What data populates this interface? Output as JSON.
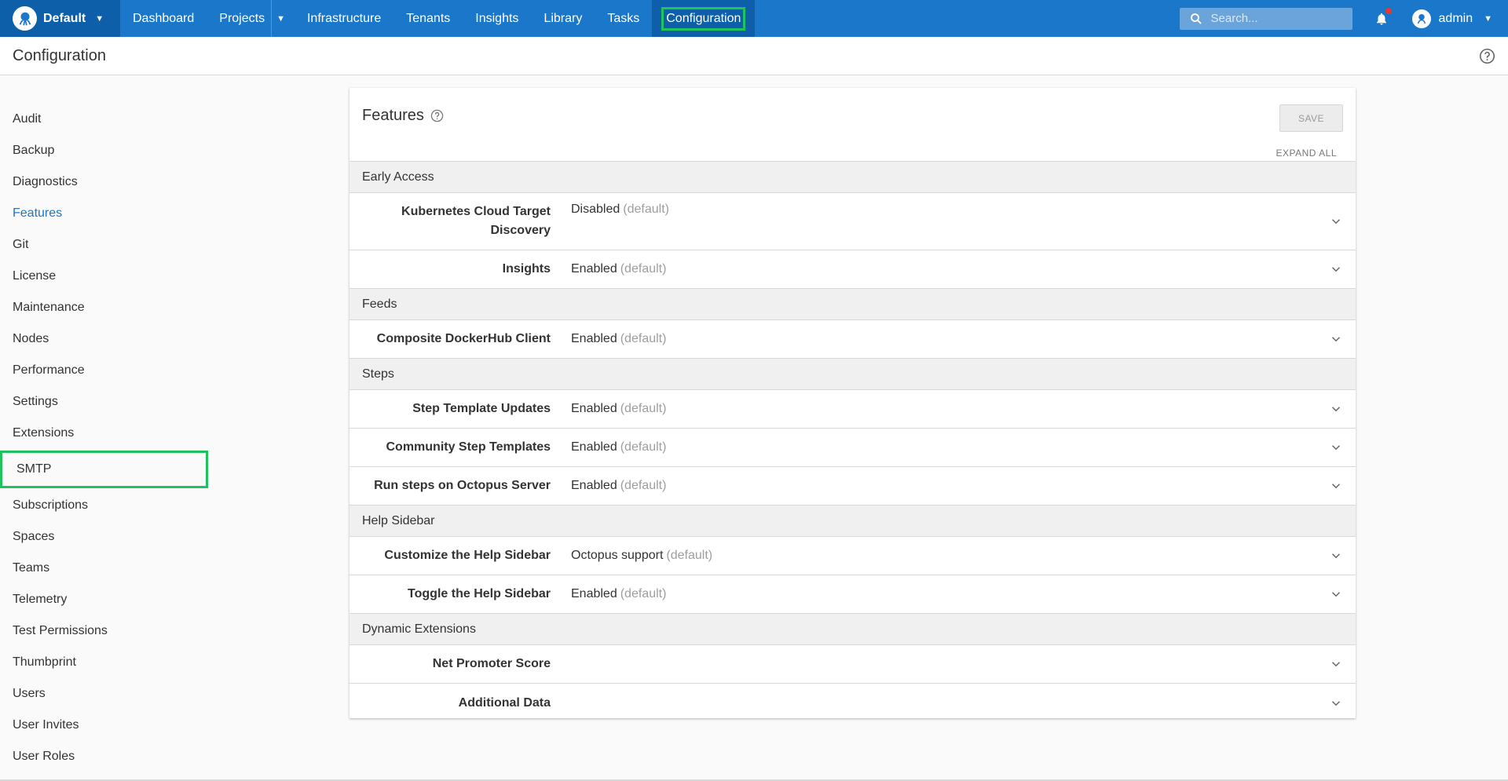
{
  "topnav": {
    "space_name": "Default",
    "items": [
      "Dashboard",
      "Projects",
      "Infrastructure",
      "Tenants",
      "Insights",
      "Library",
      "Tasks",
      "Configuration"
    ],
    "search_placeholder": "Search...",
    "user_name": "admin"
  },
  "page": {
    "title": "Configuration"
  },
  "sidebar": {
    "items": [
      "Audit",
      "Backup",
      "Diagnostics",
      "Features",
      "Git",
      "License",
      "Maintenance",
      "Nodes",
      "Performance",
      "Settings",
      "Extensions",
      "SMTP",
      "Subscriptions",
      "Spaces",
      "Teams",
      "Telemetry",
      "Test Permissions",
      "Thumbprint",
      "Users",
      "User Invites",
      "User Roles"
    ]
  },
  "features": {
    "title": "Features",
    "save_label": "SAVE",
    "expand_all_label": "EXPAND ALL",
    "default_marker": "(default)",
    "groups": [
      {
        "name": "Early Access",
        "rows": [
          {
            "label": "Kubernetes Cloud Target Discovery",
            "value": "Disabled",
            "default": "(default)"
          },
          {
            "label": "Insights",
            "value": "Enabled",
            "default": "(default)"
          }
        ]
      },
      {
        "name": "Feeds",
        "rows": [
          {
            "label": "Composite DockerHub Client",
            "value": "Enabled",
            "default": "(default)"
          }
        ]
      },
      {
        "name": "Steps",
        "rows": [
          {
            "label": "Step Template Updates",
            "value": "Enabled",
            "default": "(default)"
          },
          {
            "label": "Community Step Templates",
            "value": "Enabled",
            "default": "(default)"
          },
          {
            "label": "Run steps on Octopus Server",
            "value": "Enabled",
            "default": "(default)"
          }
        ]
      },
      {
        "name": "Help Sidebar",
        "rows": [
          {
            "label": "Customize the Help Sidebar",
            "value": "Octopus support",
            "default": "(default)"
          },
          {
            "label": "Toggle the Help Sidebar",
            "value": "Enabled",
            "default": "(default)"
          }
        ]
      },
      {
        "name": "Dynamic Extensions",
        "rows": [
          {
            "label": "Net Promoter Score",
            "value": "",
            "default": ""
          },
          {
            "label": "Additional Data",
            "value": "",
            "default": ""
          }
        ]
      }
    ]
  },
  "colors": {
    "nav_bg": "#1a77ca",
    "nav_active_bg": "#0d5faa",
    "highlight": "#1fc35c",
    "link_active": "#1a77ca"
  },
  "icons": [
    "octopus-logo-icon",
    "caret-down-icon",
    "search-icon",
    "bell-icon",
    "user-avatar-icon",
    "help-circle-icon",
    "chevron-down-icon"
  ]
}
